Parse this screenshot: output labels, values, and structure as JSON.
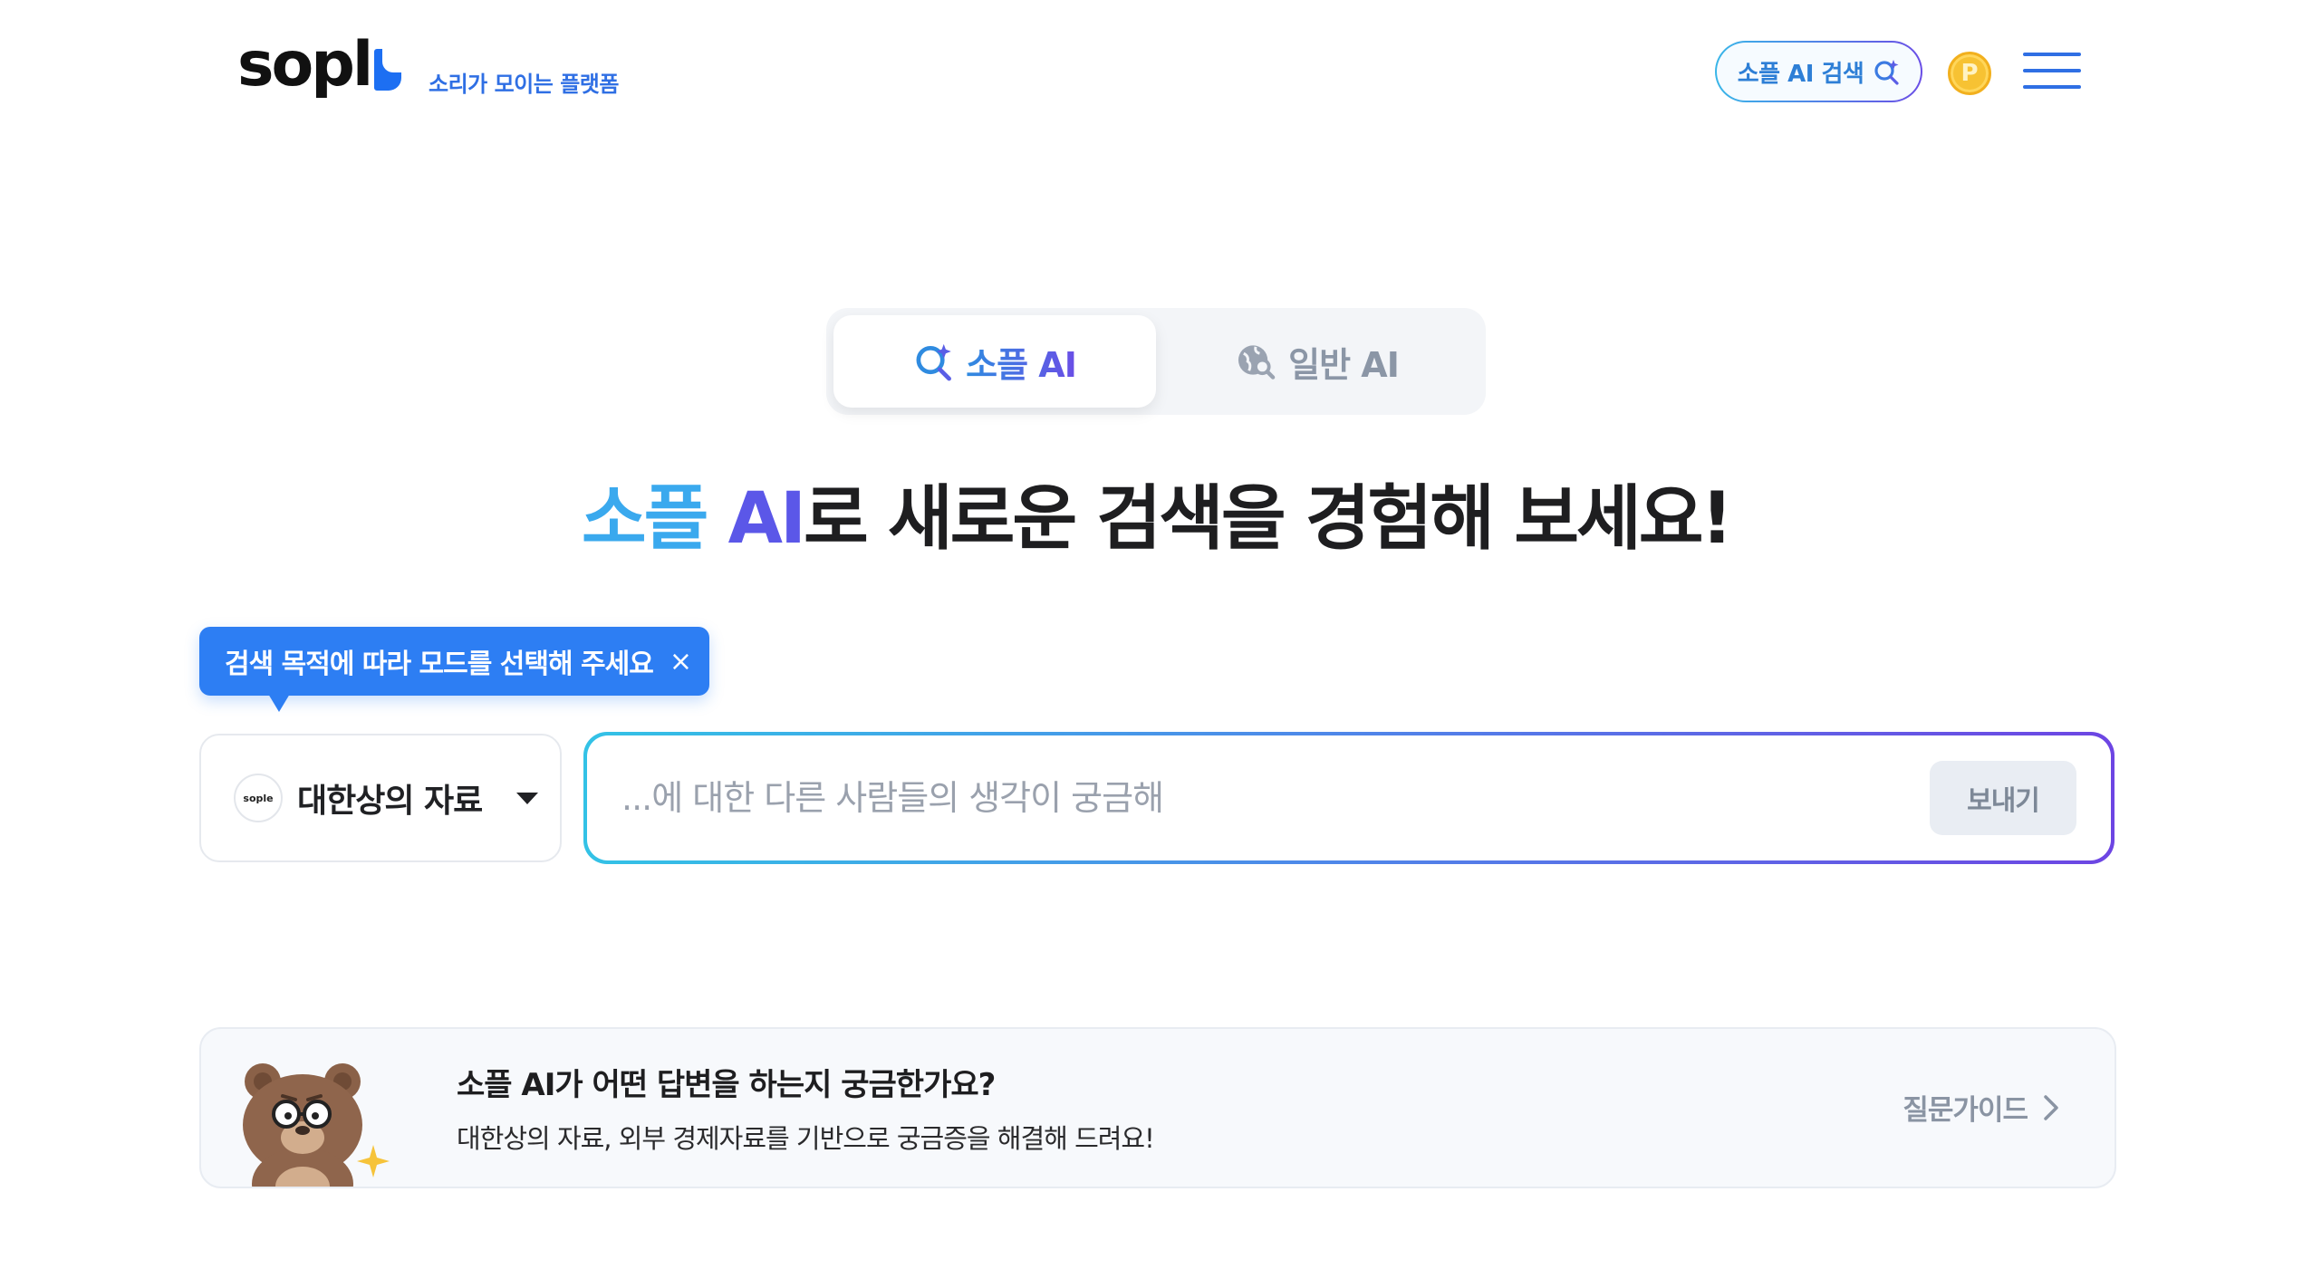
{
  "header": {
    "logo_text": "sopl",
    "tagline": "소리가 모이는 플랫폼",
    "ai_search_label": "소플 AI 검색",
    "point_symbol": "P",
    "icons": [
      "ai-sparkle-search-icon",
      "point-coin-icon",
      "hamburger-menu-icon"
    ]
  },
  "mode_toggle": {
    "tabs": [
      {
        "label": "소플 AI",
        "active": true,
        "icon": "ai-sparkle-search-icon"
      },
      {
        "label": "일반 AI",
        "active": false,
        "icon": "globe-search-icon"
      }
    ]
  },
  "headline": {
    "part1": "소플",
    "part2": "AI",
    "rest": "로 새로운 검색을 경험해 보세요!"
  },
  "tooltip": {
    "text": "검색 목적에 따라 모드를 선택해 주세요",
    "close_symbol": "×"
  },
  "search": {
    "source": {
      "badge": "sople",
      "selected": "대한상의 자료"
    },
    "placeholder": "...에 대한 다른 사람들의 생각이 궁금해",
    "value": "",
    "send_label": "보내기"
  },
  "banner": {
    "title": "소플 AI가 어떤 답변을 하는지 궁금한가요?",
    "description": "대한상의 자료, 외부 경제자료를 기반으로 궁금증을 해결해 드려요!",
    "link_label": "질문가이드",
    "mascot": "bear-with-glasses"
  },
  "colors": {
    "brand_blue": "#2f6fe4",
    "gradient_start": "#33c2e6",
    "gradient_end": "#6d45e3",
    "tooltip_blue": "#2d7ef3",
    "coin_yellow": "#f7c233"
  }
}
